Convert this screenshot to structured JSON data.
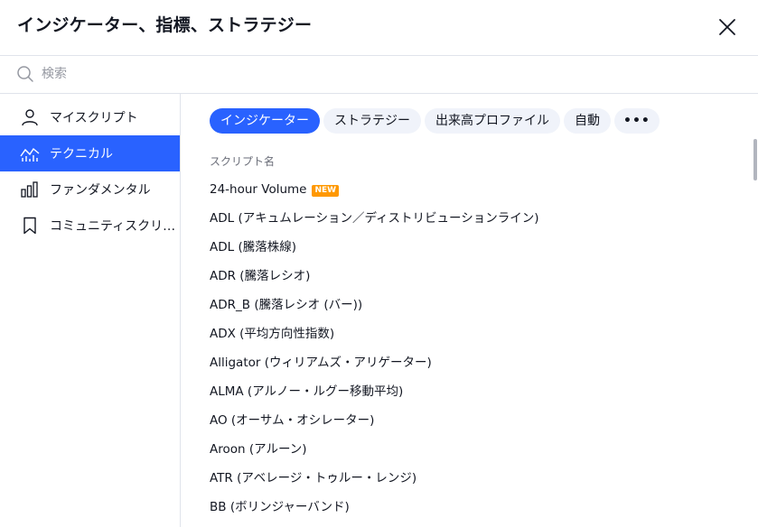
{
  "dialog": {
    "title": "インジケーター、指標、ストラテジー"
  },
  "search": {
    "placeholder": "検索",
    "value": ""
  },
  "sidebar": {
    "items": [
      {
        "label": "マイスクリプト",
        "icon": "person-icon",
        "active": false
      },
      {
        "label": "テクニカル",
        "icon": "technical-chart-icon",
        "active": true
      },
      {
        "label": "ファンダメンタル",
        "icon": "bar-chart-icon",
        "active": false
      },
      {
        "label": "コミュニティスクリプト",
        "icon": "bookmark-icon",
        "active": false
      }
    ]
  },
  "tabs": [
    {
      "label": "インジケーター",
      "active": true
    },
    {
      "label": "ストラテジー",
      "active": false
    },
    {
      "label": "出来高プロファイル",
      "active": false
    },
    {
      "label": "自動",
      "active": false
    },
    {
      "label": "•••",
      "active": false
    }
  ],
  "list": {
    "header": "スクリプト名",
    "badge_new": "NEW",
    "rows": [
      {
        "name": "24-hour Volume",
        "badge": true
      },
      {
        "name": "ADL (アキュムレーション／ディストリビューションライン)",
        "badge": false
      },
      {
        "name": "ADL (騰落株線)",
        "badge": false
      },
      {
        "name": "ADR (騰落レシオ)",
        "badge": false
      },
      {
        "name": "ADR_B (騰落レシオ (バー))",
        "badge": false
      },
      {
        "name": "ADX (平均方向性指数)",
        "badge": false
      },
      {
        "name": "Alligator (ウィリアムズ・アリゲーター)",
        "badge": false
      },
      {
        "name": "ALMA (アルノー・ルグー移動平均)",
        "badge": false
      },
      {
        "name": "AO (オーサム・オシレーター)",
        "badge": false
      },
      {
        "name": "Aroon (アルーン)",
        "badge": false
      },
      {
        "name": "ATR (アベレージ・トゥルー・レンジ)",
        "badge": false
      },
      {
        "name": "BB (ボリンジャーバンド)",
        "badge": false
      }
    ]
  },
  "colors": {
    "accent": "#2962ff",
    "chip_bg": "#f0f3fa",
    "badge_new": "#ff9800",
    "text": "#131722",
    "muted": "#6a6d78",
    "border": "#e0e3eb"
  }
}
